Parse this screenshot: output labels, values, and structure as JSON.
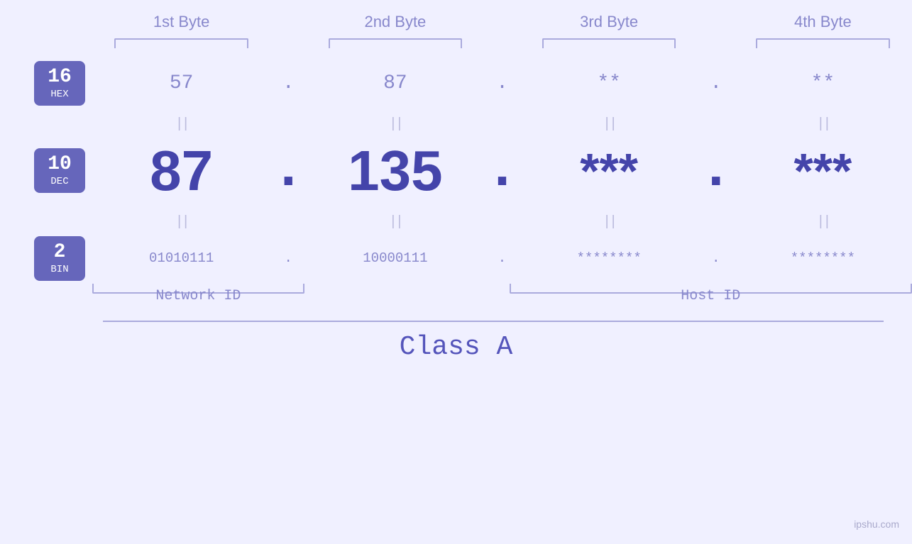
{
  "header": {
    "byte1": "1st Byte",
    "byte2": "2nd Byte",
    "byte3": "3rd Byte",
    "byte4": "4th Byte"
  },
  "labels": {
    "hex": {
      "number": "16",
      "name": "HEX"
    },
    "dec": {
      "number": "10",
      "name": "DEC"
    },
    "bin": {
      "number": "2",
      "name": "BIN"
    }
  },
  "hex_row": {
    "b1": "57",
    "b2": "87",
    "b3": "**",
    "b4": "**",
    "dot": "."
  },
  "dec_row": {
    "b1": "87",
    "b2": "135",
    "b3": "***",
    "b4": "***",
    "dot": "."
  },
  "bin_row": {
    "b1": "01010111",
    "b2": "10000111",
    "b3": "********",
    "b4": "********",
    "dot": "."
  },
  "equals_sign": "||",
  "network_id_label": "Network ID",
  "host_id_label": "Host ID",
  "class_label": "Class A",
  "watermark": "ipshu.com"
}
